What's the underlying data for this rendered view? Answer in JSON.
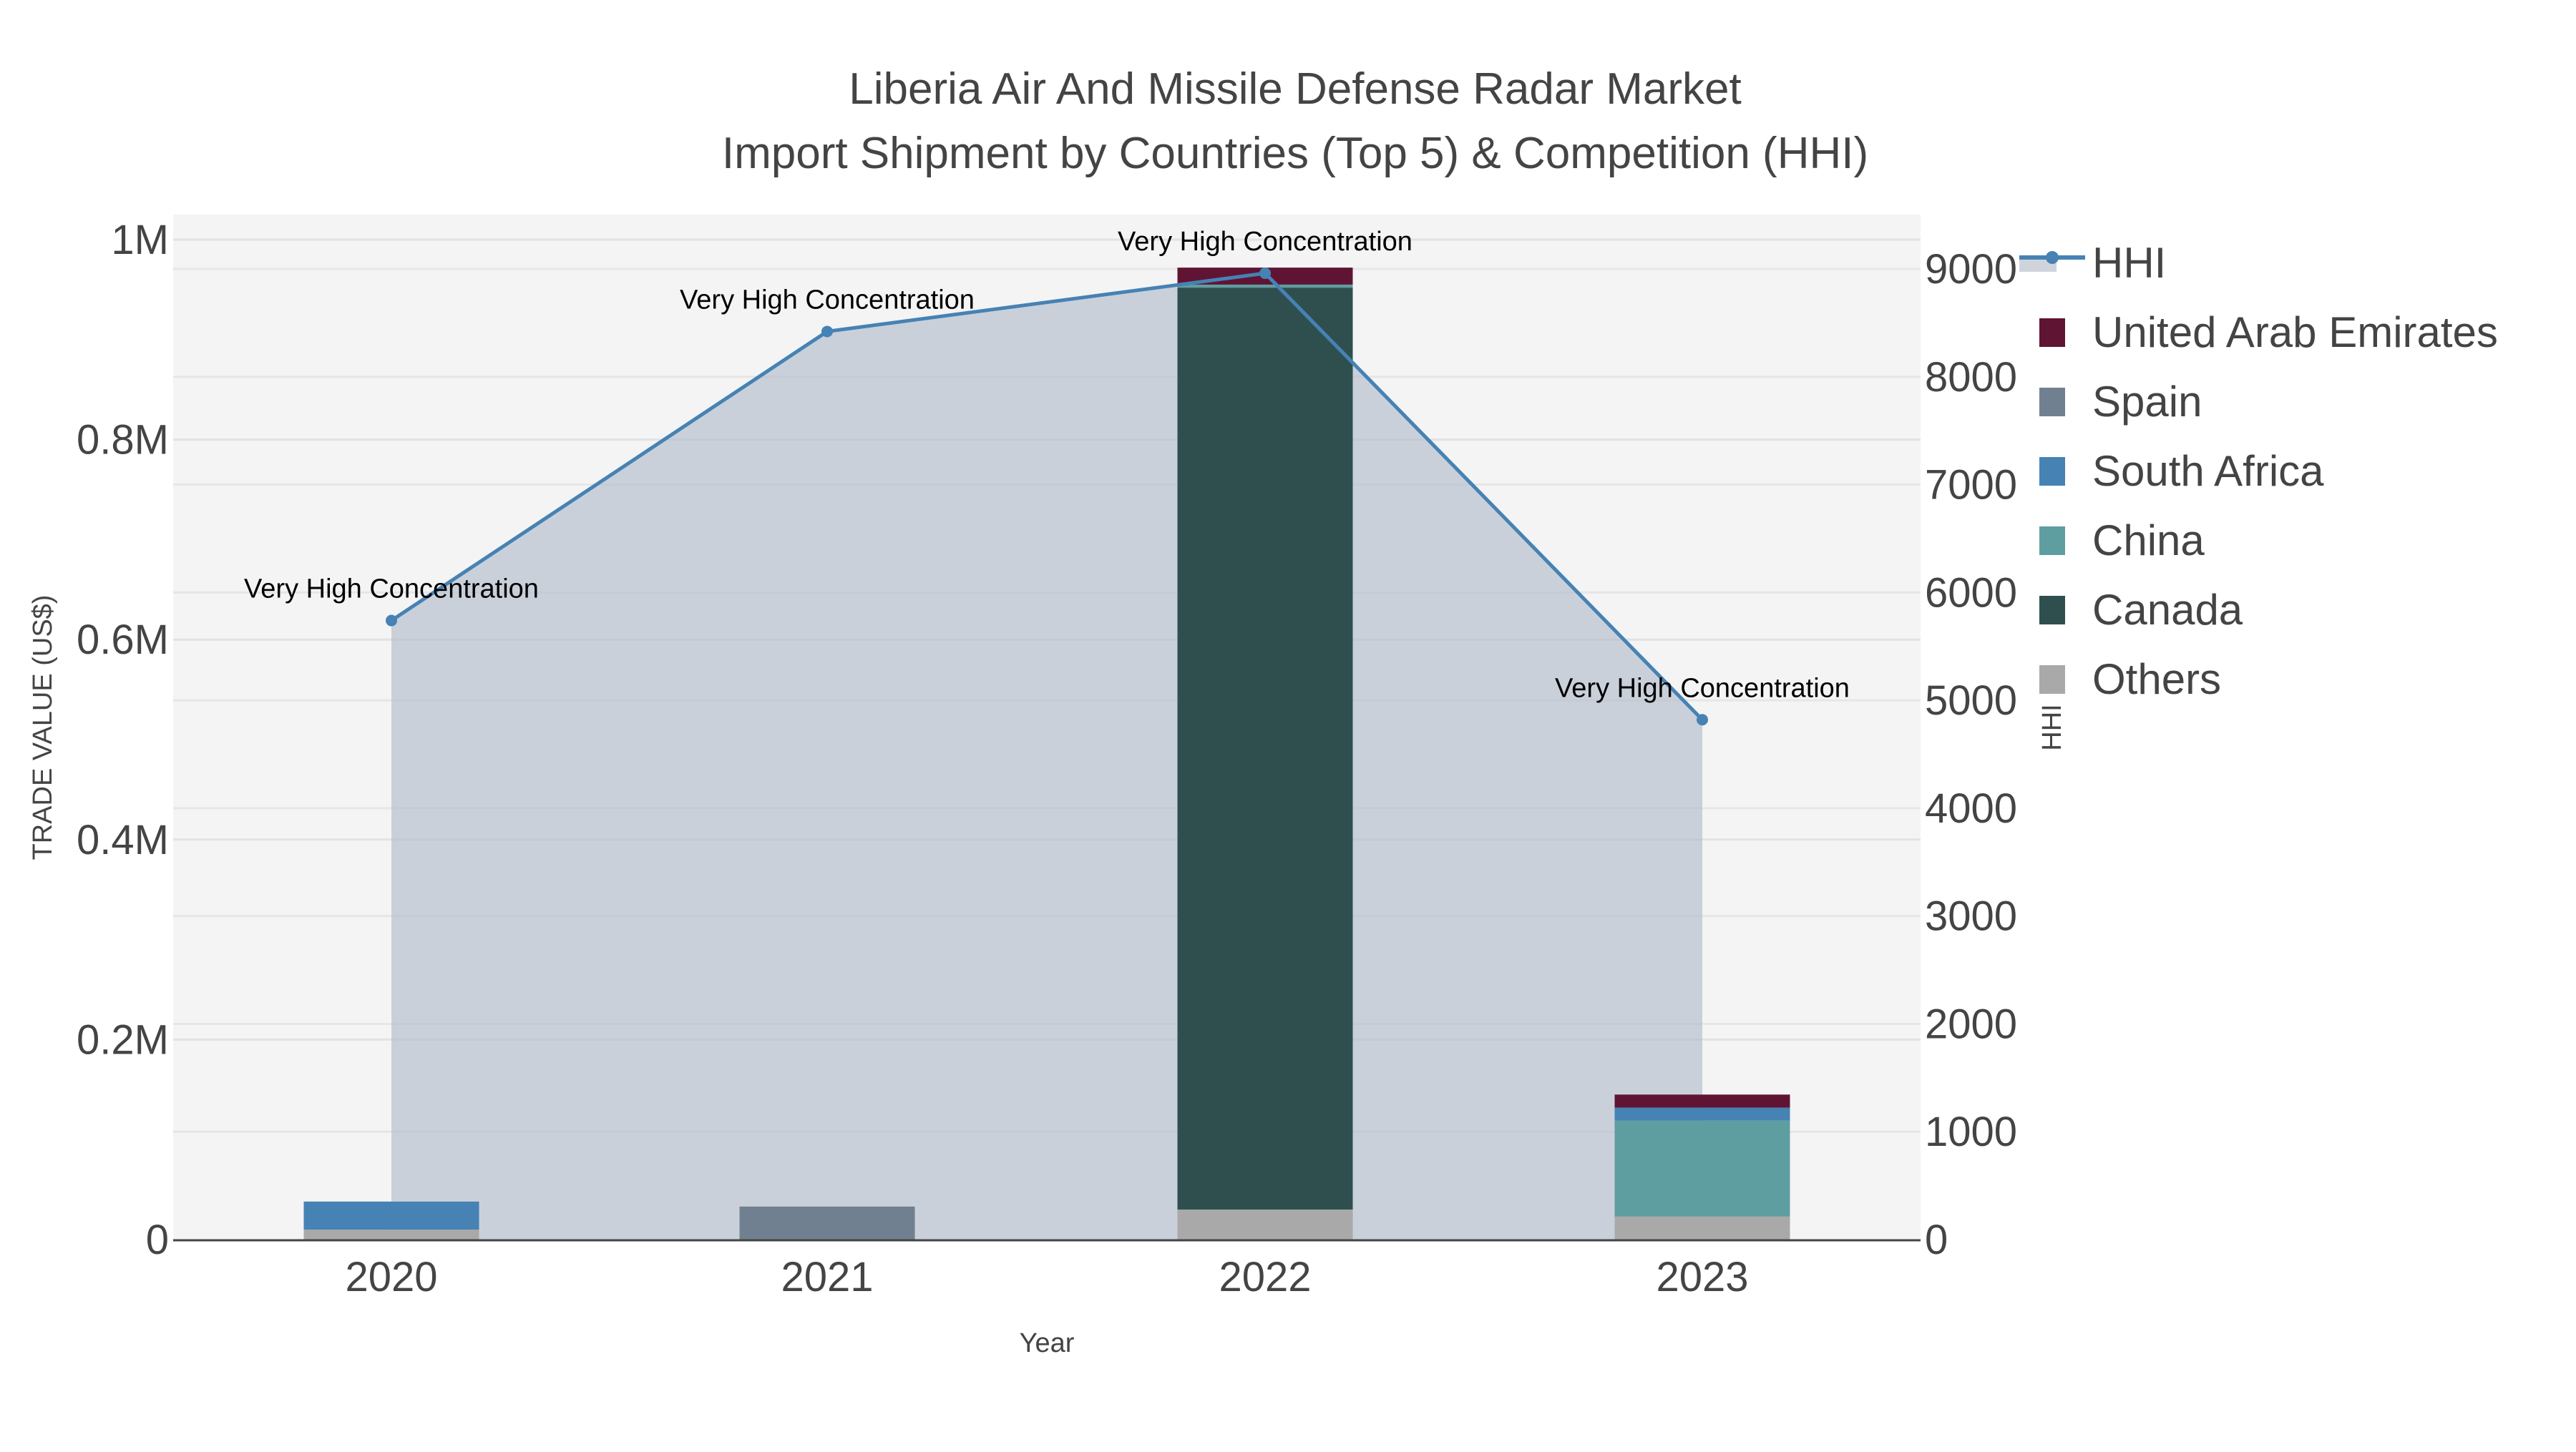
{
  "chart_data": {
    "type": "bar",
    "title": "Liberia Air And Missile Defense Radar Market",
    "subtitle": "Import Shipment by Countries (Top 5) & Competition (HHI)",
    "xlabel": "Year",
    "ylabel": "TRADE VALUE (US$)",
    "y2label": "HHI",
    "categories": [
      "2020",
      "2021",
      "2022",
      "2023"
    ],
    "ylim": [
      0,
      1020000
    ],
    "y_ticks": [
      {
        "v": 0,
        "label": "0"
      },
      {
        "v": 200000,
        "label": "0.2M"
      },
      {
        "v": 400000,
        "label": "0.4M"
      },
      {
        "v": 600000,
        "label": "0.6M"
      },
      {
        "v": 800000,
        "label": "0.8M"
      },
      {
        "v": 1000000,
        "label": "1M"
      }
    ],
    "y2lim": [
      0,
      9400
    ],
    "y2_ticks": [
      {
        "v": 0,
        "label": "0"
      },
      {
        "v": 1000,
        "label": "1000"
      },
      {
        "v": 2000,
        "label": "2000"
      },
      {
        "v": 3000,
        "label": "3000"
      },
      {
        "v": 4000,
        "label": "4000"
      },
      {
        "v": 5000,
        "label": "5000"
      },
      {
        "v": 6000,
        "label": "6000"
      },
      {
        "v": 7000,
        "label": "7000"
      },
      {
        "v": 8000,
        "label": "8000"
      },
      {
        "v": 9000,
        "label": "9000"
      }
    ],
    "grid": true,
    "legend_position": "right",
    "series": [
      {
        "name": "Others",
        "color": "#a9a9a9",
        "values": [
          10000,
          0,
          30000,
          23000
        ]
      },
      {
        "name": "Canada",
        "color": "#2f4f4f",
        "values": [
          0,
          0,
          922000,
          0
        ]
      },
      {
        "name": "China",
        "color": "#5f9ea0",
        "values": [
          0,
          0,
          3000,
          96000
        ]
      },
      {
        "name": "South Africa",
        "color": "#4682b4",
        "values": [
          28000,
          0,
          0,
          13000
        ]
      },
      {
        "name": "Spain",
        "color": "#708090",
        "values": [
          0,
          33000,
          0,
          0
        ]
      },
      {
        "name": "United Arab Emirates",
        "color": "#601434",
        "values": [
          0,
          0,
          17000,
          13000
        ]
      }
    ],
    "hhi": {
      "name": "HHI",
      "color": "#4682b4",
      "values": [
        5740,
        8420,
        8960,
        4820
      ],
      "annotations": [
        "Very High Concentration",
        "Very High Concentration",
        "Very High Concentration",
        "Very High Concentration"
      ]
    },
    "legend_order": [
      "HHI",
      "United Arab Emirates",
      "Spain",
      "South Africa",
      "China",
      "Canada",
      "Others"
    ]
  }
}
